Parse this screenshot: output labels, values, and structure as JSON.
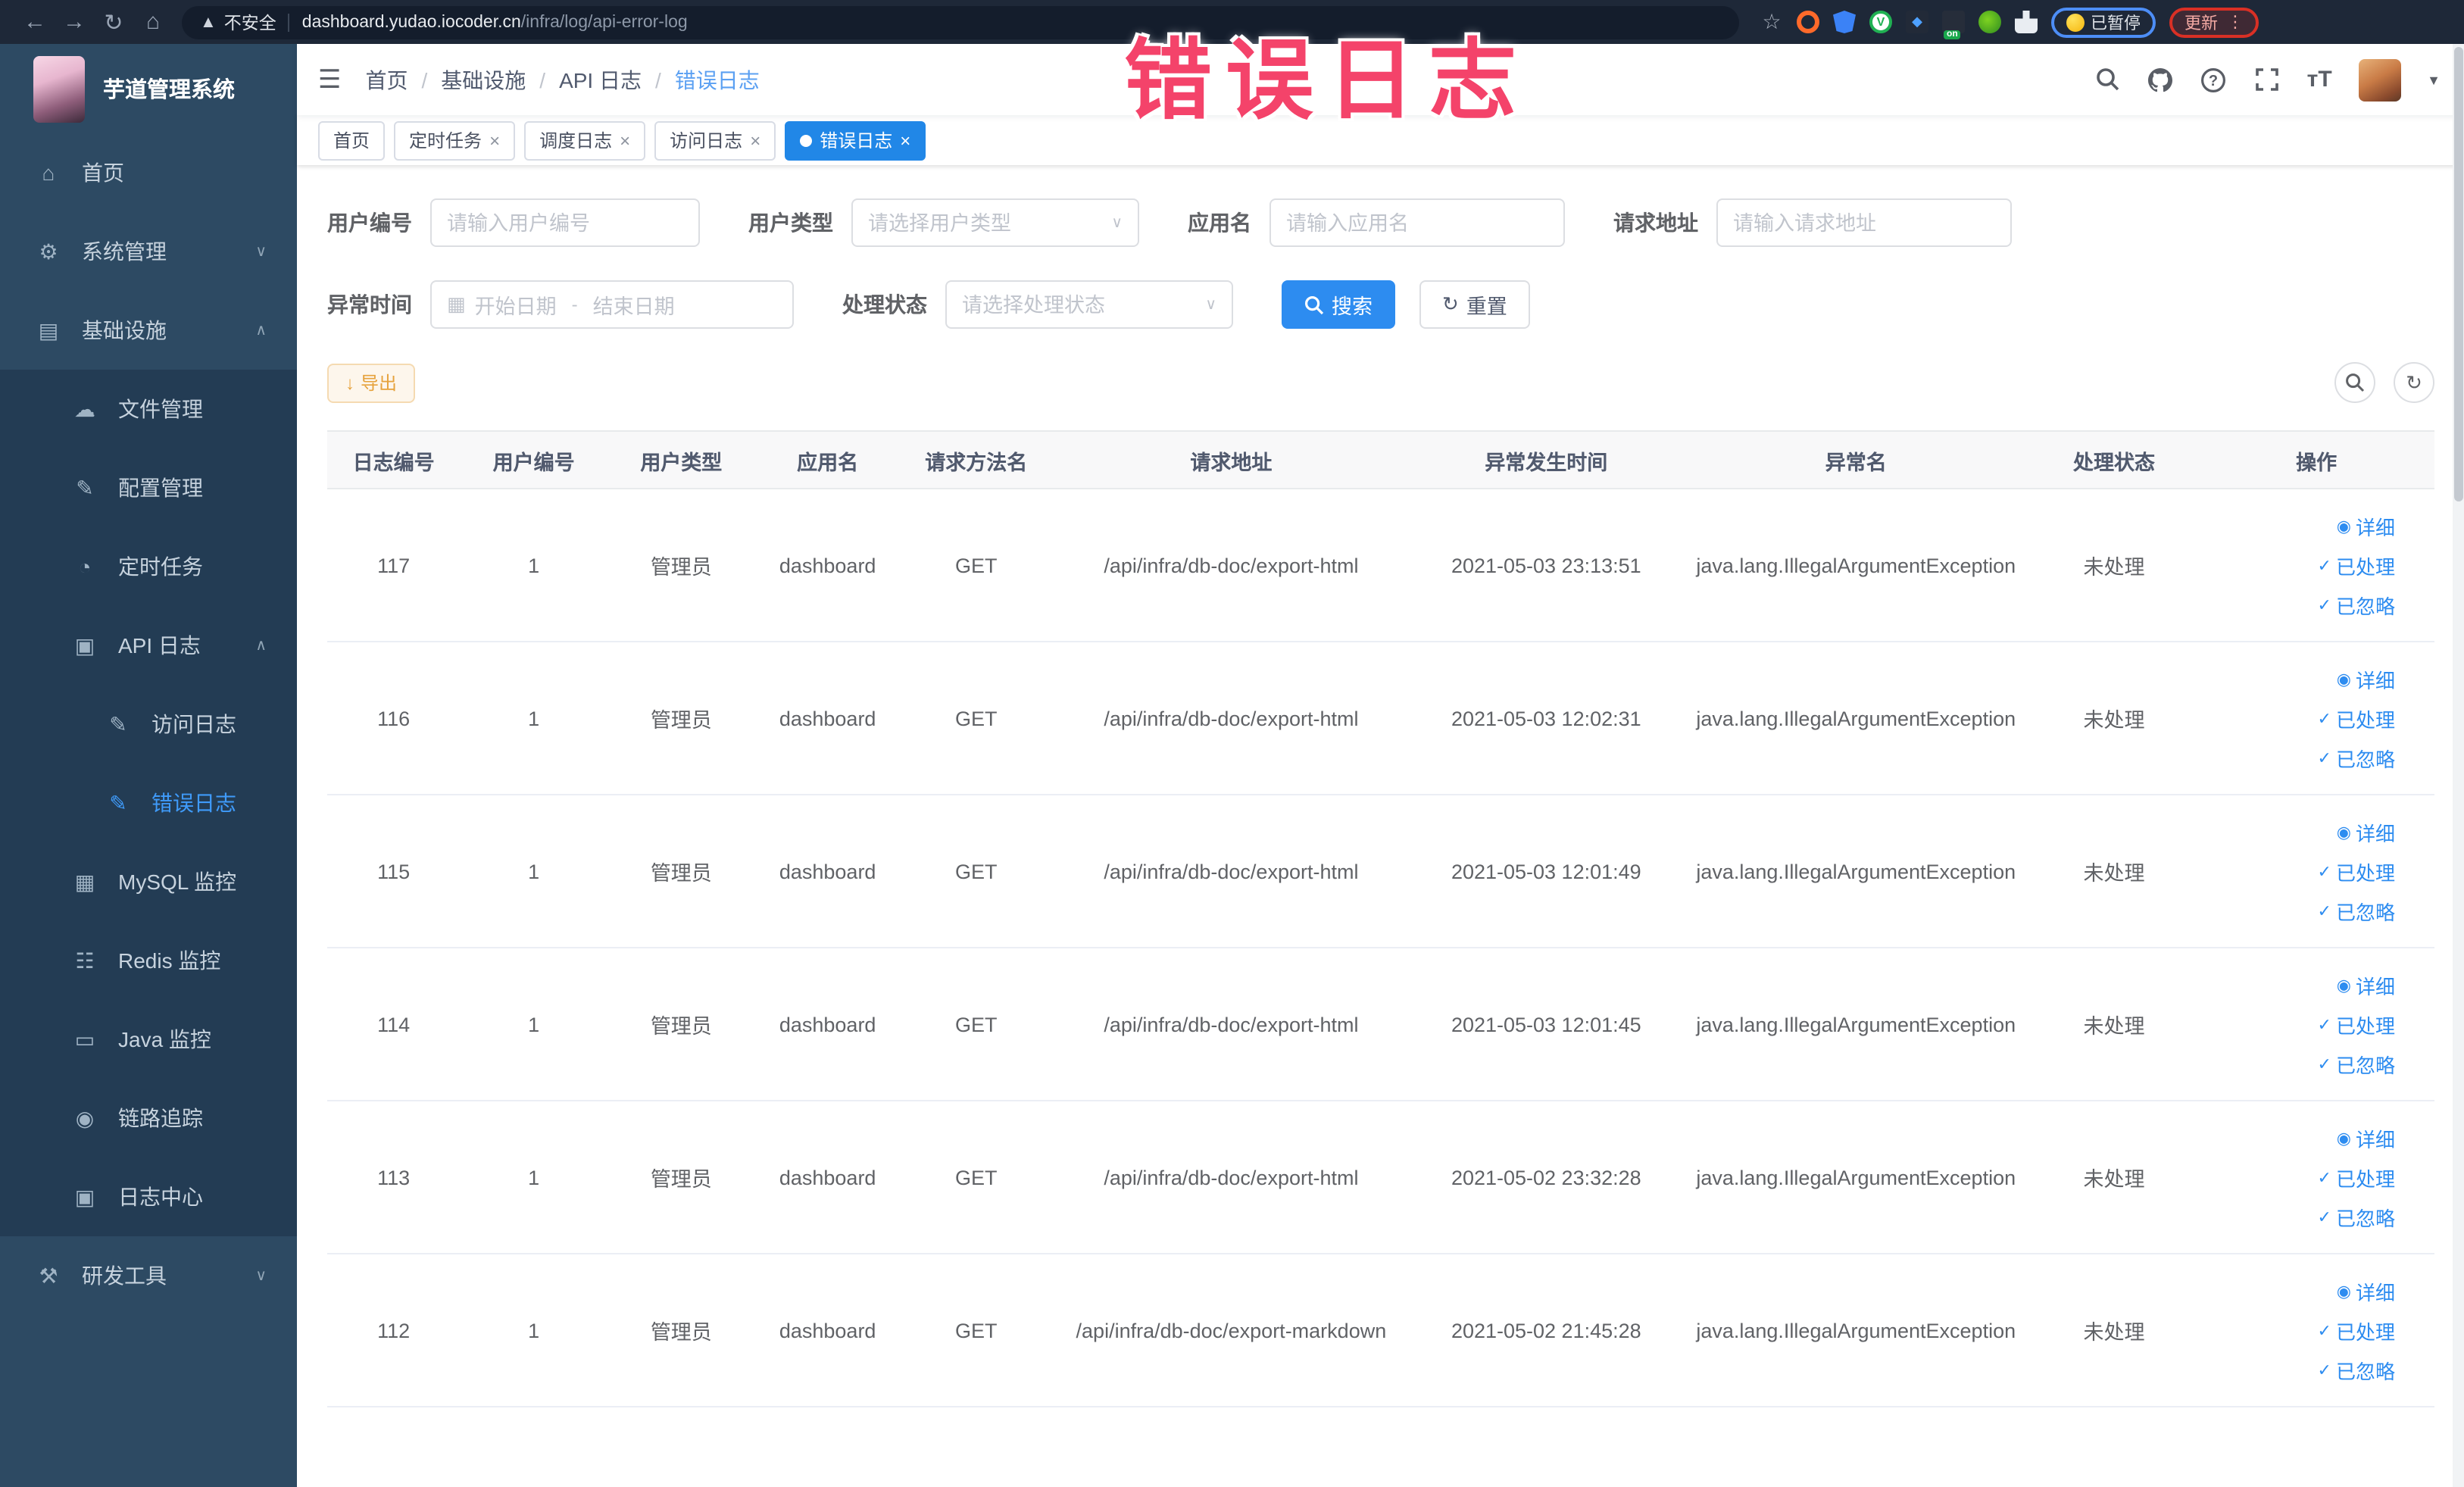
{
  "browser": {
    "nav_icons": [
      "back-arrow",
      "forward-arrow",
      "reload",
      "home"
    ],
    "security_text": "不安全",
    "url_host": "dashboard.yudao.iocoder.cn",
    "url_path": "/infra/log/api-error-log",
    "bookmark_icon": "star-outline",
    "extensions": [
      "ring-orange",
      "shield-blue",
      "circle-green",
      "grid-drop",
      "switch-on",
      "leaf-green",
      "puzzle-white"
    ],
    "paused_chip": "已暂停",
    "update_chip": "更新"
  },
  "overlay": {
    "text": "错误日志",
    "color": "#f4436a"
  },
  "sidebar": {
    "title": "芋道管理系统",
    "items": [
      {
        "label": "首页",
        "icon": "home-icon",
        "level": "root",
        "chevron": "",
        "active": false
      },
      {
        "label": "系统管理",
        "icon": "gear-icon",
        "level": "root",
        "chevron": "down",
        "active": false
      },
      {
        "label": "基础设施",
        "icon": "infra-icon",
        "level": "root",
        "chevron": "up",
        "active": false
      },
      {
        "label": "文件管理",
        "icon": "cloud-upload-icon",
        "level": "sub",
        "chevron": "",
        "active": false
      },
      {
        "label": "配置管理",
        "icon": "edit-icon",
        "level": "sub",
        "chevron": "",
        "active": false
      },
      {
        "label": "定时任务",
        "icon": "timer-icon",
        "level": "sub",
        "chevron": "",
        "active": false
      },
      {
        "label": "API 日志",
        "icon": "api-log-icon",
        "level": "sub",
        "chevron": "up",
        "active": false
      },
      {
        "label": "访问日志",
        "icon": "access-log-icon",
        "level": "subsub",
        "chevron": "",
        "active": false
      },
      {
        "label": "错误日志",
        "icon": "error-log-icon",
        "level": "subsub",
        "chevron": "",
        "active": true
      },
      {
        "label": "MySQL 监控",
        "icon": "mysql-icon",
        "level": "sub",
        "chevron": "",
        "active": false
      },
      {
        "label": "Redis 监控",
        "icon": "redis-icon",
        "level": "sub",
        "chevron": "",
        "active": false
      },
      {
        "label": "Java 监控",
        "icon": "java-icon",
        "level": "sub",
        "chevron": "",
        "active": false
      },
      {
        "label": "链路追踪",
        "icon": "trace-icon",
        "level": "sub",
        "chevron": "",
        "active": false
      },
      {
        "label": "日志中心",
        "icon": "log-center-icon",
        "level": "sub",
        "chevron": "",
        "active": false
      },
      {
        "label": "研发工具",
        "icon": "tools-icon",
        "level": "root",
        "chevron": "down",
        "active": false
      }
    ]
  },
  "header": {
    "breadcrumb": [
      "首页",
      "基础设施",
      "API 日志",
      "错误日志"
    ],
    "right_icons": [
      "search-icon",
      "github-icon",
      "help-icon",
      "fullscreen-icon",
      "font-size-icon",
      "avatar",
      "caret-down-icon"
    ]
  },
  "tabs": [
    {
      "label": "首页",
      "closable": false,
      "active": false
    },
    {
      "label": "定时任务",
      "closable": true,
      "active": false
    },
    {
      "label": "调度日志",
      "closable": true,
      "active": false
    },
    {
      "label": "访问日志",
      "closable": true,
      "active": false
    },
    {
      "label": "错误日志",
      "closable": true,
      "active": true
    }
  ],
  "filters": {
    "user_id": {
      "label": "用户编号",
      "placeholder": "请输入用户编号"
    },
    "user_type": {
      "label": "用户类型",
      "placeholder": "请选择用户类型"
    },
    "app_name": {
      "label": "应用名",
      "placeholder": "请输入应用名"
    },
    "request_url": {
      "label": "请求地址",
      "placeholder": "请输入请求地址"
    },
    "exception_time": {
      "label": "异常时间",
      "start_placeholder": "开始日期",
      "separator": "-",
      "end_placeholder": "结束日期"
    },
    "process_status": {
      "label": "处理状态",
      "placeholder": "请选择处理状态"
    },
    "search_label": "搜索",
    "reset_label": "重置"
  },
  "toolbar": {
    "export_label": "导出"
  },
  "table": {
    "columns": [
      "日志编号",
      "用户编号",
      "用户类型",
      "应用名",
      "请求方法名",
      "请求地址",
      "异常发生时间",
      "异常名",
      "处理状态",
      "操作"
    ],
    "col_widths": [
      "6.3%",
      "7.0%",
      "7.0%",
      "6.9%",
      "7.2%",
      "17.0%",
      "12.9%",
      "16.5%",
      "8.0%",
      "11.2%"
    ],
    "row_actions": [
      "详细",
      "已处理",
      "已忽略"
    ],
    "rows": [
      {
        "log_id": "117",
        "user_id": "1",
        "user_type": "管理员",
        "app_name": "dashboard",
        "method": "GET",
        "url": "/api/infra/db-doc/export-html",
        "time": "2021-05-03 23:13:51",
        "exception": "java.lang.IllegalArgumentException",
        "status": "未处理"
      },
      {
        "log_id": "116",
        "user_id": "1",
        "user_type": "管理员",
        "app_name": "dashboard",
        "method": "GET",
        "url": "/api/infra/db-doc/export-html",
        "time": "2021-05-03 12:02:31",
        "exception": "java.lang.IllegalArgumentException",
        "status": "未处理"
      },
      {
        "log_id": "115",
        "user_id": "1",
        "user_type": "管理员",
        "app_name": "dashboard",
        "method": "GET",
        "url": "/api/infra/db-doc/export-html",
        "time": "2021-05-03 12:01:49",
        "exception": "java.lang.IllegalArgumentException",
        "status": "未处理"
      },
      {
        "log_id": "114",
        "user_id": "1",
        "user_type": "管理员",
        "app_name": "dashboard",
        "method": "GET",
        "url": "/api/infra/db-doc/export-html",
        "time": "2021-05-03 12:01:45",
        "exception": "java.lang.IllegalArgumentException",
        "status": "未处理"
      },
      {
        "log_id": "113",
        "user_id": "1",
        "user_type": "管理员",
        "app_name": "dashboard",
        "method": "GET",
        "url": "/api/infra/db-doc/export-html",
        "time": "2021-05-02 23:32:28",
        "exception": "java.lang.IllegalArgumentException",
        "status": "未处理"
      },
      {
        "log_id": "112",
        "user_id": "1",
        "user_type": "管理员",
        "app_name": "dashboard",
        "method": "GET",
        "url": "/api/infra/db-doc/export-markdown",
        "time": "2021-05-02 21:45:28",
        "exception": "java.lang.IllegalArgumentException",
        "status": "未处理"
      }
    ]
  },
  "colors": {
    "accent": "#2d8cf0",
    "active_tab": "#2187e7",
    "warning": "#e6a23c",
    "sidebar_bg": "#2d4a63",
    "submenu_bg": "#233c54"
  }
}
